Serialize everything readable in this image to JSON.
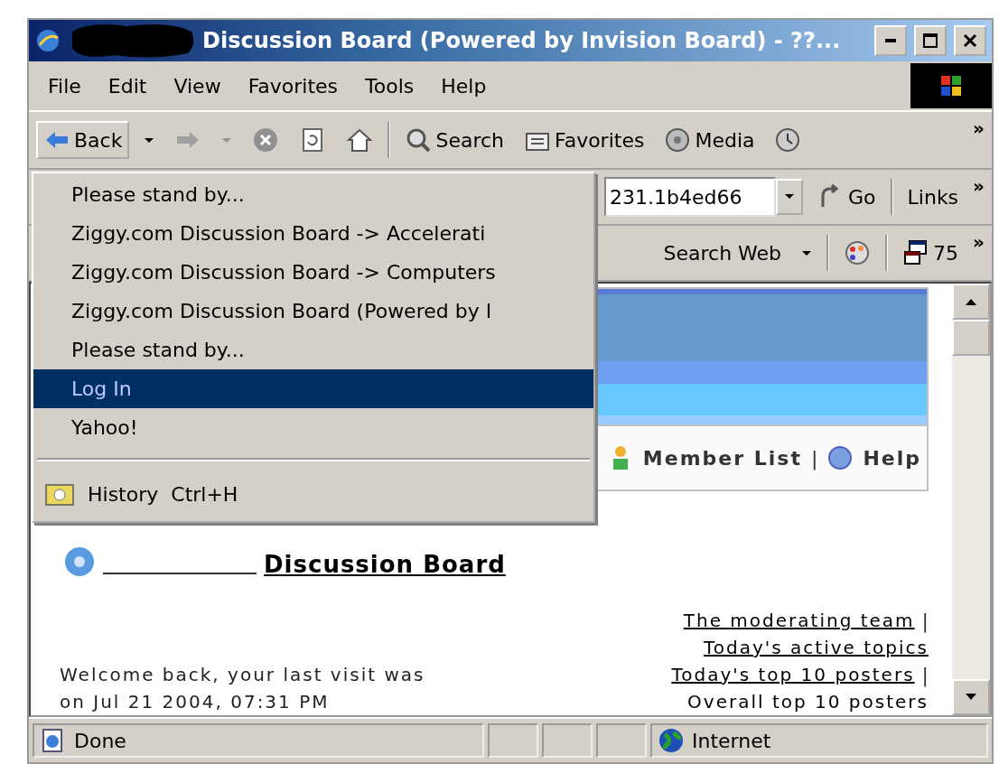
{
  "window": {
    "title": "Discussion Board (Powered by Invision Board) - ??..."
  },
  "menu_bar": [
    "File",
    "Edit",
    "View",
    "Favorites",
    "Tools",
    "Help"
  ],
  "toolbar": {
    "back": "Back",
    "search": "Search",
    "favorites": "Favorites",
    "media": "Media",
    "more": "»"
  },
  "address_bar": {
    "value": "231.1b4ed66",
    "go": "Go",
    "links": "Links",
    "more": "»"
  },
  "search_toolbar": {
    "search_web": "Search Web",
    "counter": "75",
    "more": "»"
  },
  "back_menu": {
    "items": [
      {
        "label": "Please stand by...",
        "selected": false
      },
      {
        "label": "Ziggy.com Discussion Board -> Accelerati",
        "selected": false
      },
      {
        "label": "Ziggy.com Discussion Board -> Computers",
        "selected": false
      },
      {
        "label": "Ziggy.com Discussion Board (Powered by I",
        "selected": false
      },
      {
        "label": "Please stand by...",
        "selected": false
      },
      {
        "label": "Log In",
        "selected": true
      },
      {
        "label": "Yahoo!",
        "selected": false
      }
    ],
    "history": {
      "label": "History",
      "shortcut": "Ctrl+H"
    }
  },
  "page": {
    "nav": [
      {
        "label": "Member List",
        "separator": "|"
      },
      {
        "label": "Help"
      }
    ],
    "board_title": "Discussion Board",
    "welcome": [
      "Welcome back, your last visit was",
      "on Jul 21 2004, 07:31 PM"
    ],
    "links": [
      {
        "label": "The moderating team",
        "link": true,
        "separator": "|"
      },
      {
        "label": "Today's active topics",
        "link": true
      },
      {
        "label": "Today's top 10 posters",
        "link": true,
        "separator": "|"
      },
      {
        "label": "Overall top 10 posters",
        "link": false
      }
    ]
  },
  "status_bar": {
    "text": "Done",
    "zone": "Internet"
  }
}
